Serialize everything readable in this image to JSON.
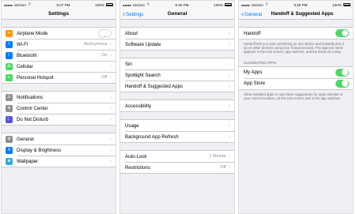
{
  "colors": {
    "accent": "#007aff",
    "toggle_on": "#4cd964",
    "background": "#efeff4",
    "separator": "#c8c7cc"
  },
  "screen1": {
    "status": {
      "carrier": "Verizon",
      "time": "9:27 PM",
      "battery": "100%"
    },
    "title": "Settings",
    "group1": [
      {
        "label": "Airplane Mode",
        "icon": "airplane-icon",
        "icon_color": "#ff9500",
        "toggle": "off"
      },
      {
        "label": "Wi-Fi",
        "icon": "wifi-icon",
        "icon_color": "#007aff",
        "value": "Anonymous"
      },
      {
        "label": "Bluetooth",
        "icon": "bluetooth-icon",
        "icon_color": "#007aff",
        "value": "On"
      },
      {
        "label": "Cellular",
        "icon": "cellular-icon",
        "icon_color": "#4cd964",
        "value": ""
      },
      {
        "label": "Personal Hotspot",
        "icon": "hotspot-icon",
        "icon_color": "#4cd964",
        "value": "Off"
      }
    ],
    "group2": [
      {
        "label": "Notifications",
        "icon": "notifications-icon",
        "icon_color": "#8e8e93"
      },
      {
        "label": "Control Center",
        "icon": "control-center-icon",
        "icon_color": "#8e8e93"
      },
      {
        "label": "Do Not Disturb",
        "icon": "moon-icon",
        "icon_color": "#5856d6"
      }
    ],
    "group3": [
      {
        "label": "General",
        "icon": "gear-icon",
        "icon_color": "#8e8e93"
      },
      {
        "label": "Display & Brightness",
        "icon": "display-icon",
        "icon_color": "#007aff"
      },
      {
        "label": "Wallpaper",
        "icon": "wallpaper-icon",
        "icon_color": "#34aadc"
      }
    ]
  },
  "screen2": {
    "status": {
      "carrier": "Verizon",
      "time": "9:30 PM",
      "battery": "100%"
    },
    "back": "Settings",
    "title": "General",
    "group1": [
      {
        "label": "About"
      },
      {
        "label": "Software Update"
      }
    ],
    "group2": [
      {
        "label": "Siri"
      },
      {
        "label": "Spotlight Search"
      },
      {
        "label": "Handoff & Suggested Apps"
      }
    ],
    "group3": [
      {
        "label": "Accessibility"
      }
    ],
    "group4": [
      {
        "label": "Usage"
      },
      {
        "label": "Background App Refresh"
      }
    ],
    "group5": [
      {
        "label": "Auto-Lock",
        "value": "1 Minute"
      },
      {
        "label": "Restrictions",
        "value": "Off"
      }
    ]
  },
  "screen3": {
    "status": {
      "carrier": "Verizon",
      "time": "9:30 PM",
      "battery": "100%"
    },
    "back": "General",
    "title": "Handoff & Suggested Apps",
    "handoff": {
      "label": "Handoff",
      "toggle": "on"
    },
    "handoff_note": "Handoff lets you start something on one device and instantly pick it up on other devices using your iCloud account. The app you need appears in the lock screen, app switcher, and the Dock on a Mac.",
    "section_header": "SUGGESTED APPS",
    "my_apps": {
      "label": "My Apps",
      "toggle": "on"
    },
    "app_store": {
      "label": "App Store",
      "toggle": "on"
    },
    "suggested_note": "Show installed apps or App Store suggestions for apps relevant to your current location, on the lock screen and in the app switcher."
  }
}
